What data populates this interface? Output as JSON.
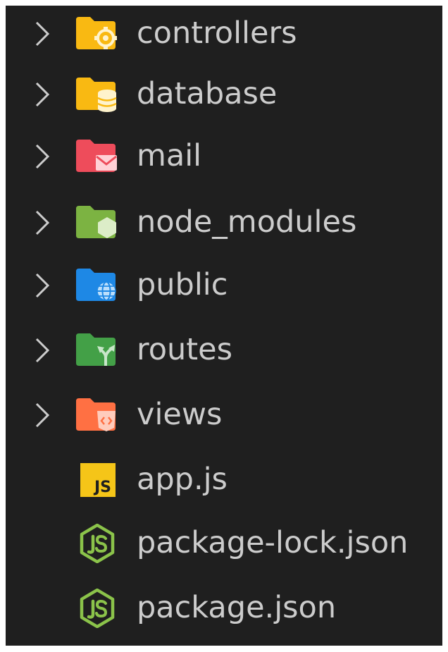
{
  "explorer": {
    "items": [
      {
        "label": "controllers",
        "type": "folder",
        "icon": "folder-controllers-icon",
        "color": "#f9b912"
      },
      {
        "label": "database",
        "type": "folder",
        "icon": "folder-database-icon",
        "color": "#f9b912"
      },
      {
        "label": "mail",
        "type": "folder",
        "icon": "folder-mail-icon",
        "color": "#ee4c5b"
      },
      {
        "label": "node_modules",
        "type": "folder",
        "icon": "folder-node-icon",
        "color": "#7cb342"
      },
      {
        "label": "public",
        "type": "folder",
        "icon": "folder-public-icon",
        "color": "#1e88e5"
      },
      {
        "label": "routes",
        "type": "folder",
        "icon": "folder-routes-icon",
        "color": "#43a047"
      },
      {
        "label": "views",
        "type": "folder",
        "icon": "folder-views-icon",
        "color": "#ff7043"
      },
      {
        "label": "app.js",
        "type": "file",
        "icon": "javascript-file-icon",
        "color": "#f5c518"
      },
      {
        "label": "package-lock.json",
        "type": "file",
        "icon": "nodejs-file-icon",
        "color": "#8bc34a"
      },
      {
        "label": "package.json",
        "type": "file",
        "icon": "nodejs-file-icon",
        "color": "#8bc34a"
      }
    ]
  }
}
